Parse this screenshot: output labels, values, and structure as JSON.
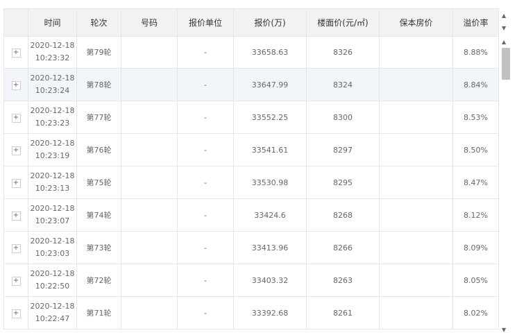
{
  "columns": [
    "",
    "时间",
    "轮次",
    "号码",
    "报价单位",
    "报价(万)",
    "楼面价(元/㎡)",
    "保本房价",
    "溢价率"
  ],
  "rows": [
    {
      "date": "2020-12-18",
      "time": "10:23:32",
      "round": "第79轮",
      "number": "",
      "unit": "-",
      "price": "33658.63",
      "floor": "8326",
      "breakeven": "",
      "premium": "8.88%"
    },
    {
      "date": "2020-12-18",
      "time": "10:23:24",
      "round": "第78轮",
      "number": "",
      "unit": "-",
      "price": "33647.99",
      "floor": "8324",
      "breakeven": "",
      "premium": "8.84%"
    },
    {
      "date": "2020-12-18",
      "time": "10:23:23",
      "round": "第77轮",
      "number": "",
      "unit": "-",
      "price": "33552.25",
      "floor": "8300",
      "breakeven": "",
      "premium": "8.53%"
    },
    {
      "date": "2020-12-18",
      "time": "10:23:19",
      "round": "第76轮",
      "number": "",
      "unit": "-",
      "price": "33541.61",
      "floor": "8297",
      "breakeven": "",
      "premium": "8.50%"
    },
    {
      "date": "2020-12-18",
      "time": "10:23:13",
      "round": "第75轮",
      "number": "",
      "unit": "-",
      "price": "33530.98",
      "floor": "8295",
      "breakeven": "",
      "premium": "8.47%"
    },
    {
      "date": "2020-12-18",
      "time": "10:23:07",
      "round": "第74轮",
      "number": "",
      "unit": "-",
      "price": "33424.6",
      "floor": "8268",
      "breakeven": "",
      "premium": "8.12%"
    },
    {
      "date": "2020-12-18",
      "time": "10:23:03",
      "round": "第73轮",
      "number": "",
      "unit": "-",
      "price": "33413.96",
      "floor": "8266",
      "breakeven": "",
      "premium": "8.09%"
    },
    {
      "date": "2020-12-18",
      "time": "10:22:50",
      "round": "第72轮",
      "number": "",
      "unit": "-",
      "price": "33403.32",
      "floor": "8263",
      "breakeven": "",
      "premium": "8.05%"
    },
    {
      "date": "2020-12-18",
      "time": "10:22:47",
      "round": "第71轮",
      "number": "",
      "unit": "-",
      "price": "33392.68",
      "floor": "8261",
      "breakeven": "",
      "premium": "8.02%"
    }
  ],
  "expand_symbol": "+",
  "colors": {
    "header_bg": "#f2f2f2",
    "highlight_row": "#f2f6fa",
    "border": "#e6e6e6"
  },
  "icons": {
    "scroll_up": "scroll-up-arrow-icon",
    "scroll_down": "scroll-down-arrow-icon",
    "expand": "plus-expand-icon"
  }
}
